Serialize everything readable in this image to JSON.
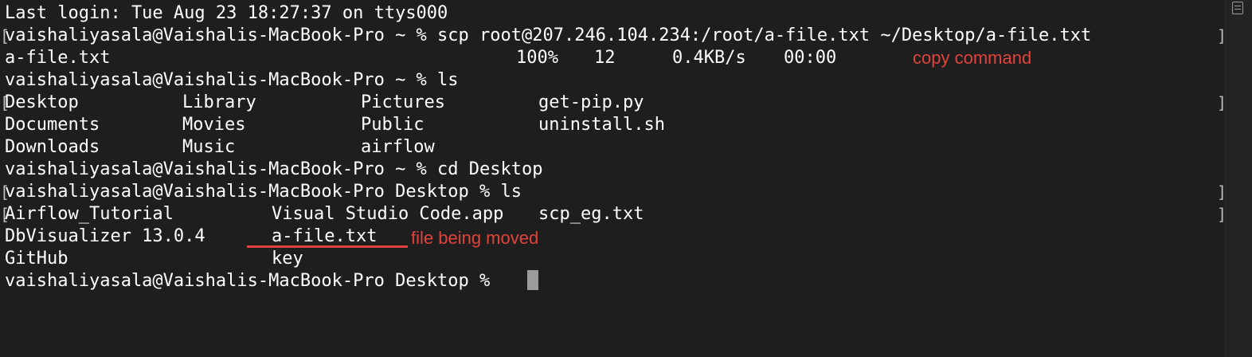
{
  "terminal": {
    "lines": [
      {
        "segments": [
          "Last login: Tue Aug 23 18:27:37 on ttys000"
        ]
      },
      {
        "segments": [
          "vaishaliyasala@Vaishalis-MacBook-Pro ~ % scp root@207.246.104.234:/root/a-file.txt ~/Desktop/a-file.txt"
        ]
      },
      {
        "segments": [
          "a-file.txt",
          "100%",
          "12",
          "0.4KB/s",
          "00:00"
        ]
      },
      {
        "segments": [
          "vaishaliyasala@Vaishalis-MacBook-Pro ~ % ls"
        ]
      },
      {
        "segments": [
          "Desktop",
          "Library",
          "Pictures",
          "get-pip.py"
        ]
      },
      {
        "segments": [
          "Documents",
          "Movies",
          "Public",
          "uninstall.sh"
        ]
      },
      {
        "segments": [
          "Downloads",
          "Music",
          "airflow"
        ]
      },
      {
        "segments": [
          "vaishaliyasala@Vaishalis-MacBook-Pro ~ % cd Desktop"
        ]
      },
      {
        "segments": [
          "vaishaliyasala@Vaishalis-MacBook-Pro Desktop % ls"
        ]
      },
      {
        "segments": [
          "Airflow_Tutorial",
          "Visual Studio Code.app",
          "scp_eg.txt"
        ]
      },
      {
        "segments": [
          "DbVisualizer 13.0.4",
          "a-file.txt"
        ]
      },
      {
        "segments": [
          "GitHub",
          "key"
        ]
      },
      {
        "segments": [
          "vaishaliyasala@Vaishalis-MacBook-Pro Desktop % "
        ]
      }
    ],
    "bracket_left": "[",
    "bracket_right": "]"
  },
  "annotations": {
    "copy_command": "copy command",
    "file_being_moved": "file being moved",
    "color": "#e0433b"
  },
  "scrollbar": {
    "button_icon": "list-icon"
  }
}
